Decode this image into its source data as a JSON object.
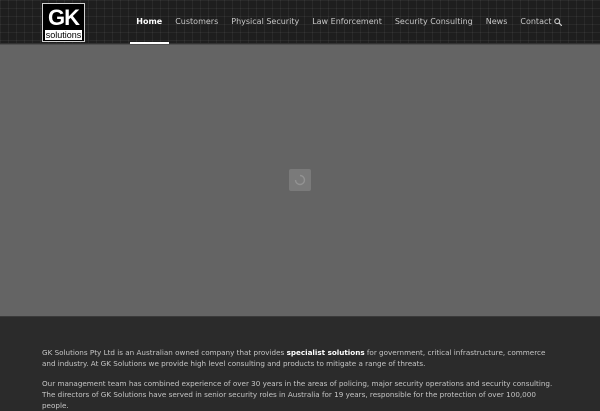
{
  "header": {
    "logo": {
      "mark": "GK",
      "sub": "solutions"
    },
    "nav": [
      {
        "label": "Home",
        "active": true
      },
      {
        "label": "Customers",
        "active": false
      },
      {
        "label": "Physical Security",
        "active": false
      },
      {
        "label": "Law Enforcement",
        "active": false
      },
      {
        "label": "Security Consulting",
        "active": false
      },
      {
        "label": "News",
        "active": false
      },
      {
        "label": "Contact",
        "active": false
      }
    ],
    "search_icon": "search-icon"
  },
  "hero": {
    "loader_icon": "loading-spinner-icon"
  },
  "content": {
    "p1": {
      "before": "GK Solutions Pty Ltd is an Australian owned company that provides ",
      "strong": "specialist solutions",
      "after": " for government, critical infrastructure, commerce and industry. At GK Solutions we provide high level consulting and products to mitigate a range of threats."
    },
    "p2": "Our management team has combined experience of over 30 years in the areas of policing, major security operations and security consulting. The directors of GK Solutions have served in senior security roles in Australia for 19 years, responsible for the protection of over 100,000 people."
  },
  "colors": {
    "header_bg": "#1e1e1e",
    "hero_bg": "#646464",
    "content_bg": "#2b2b2b",
    "text": "#c6c6c6",
    "active": "#ffffff"
  }
}
